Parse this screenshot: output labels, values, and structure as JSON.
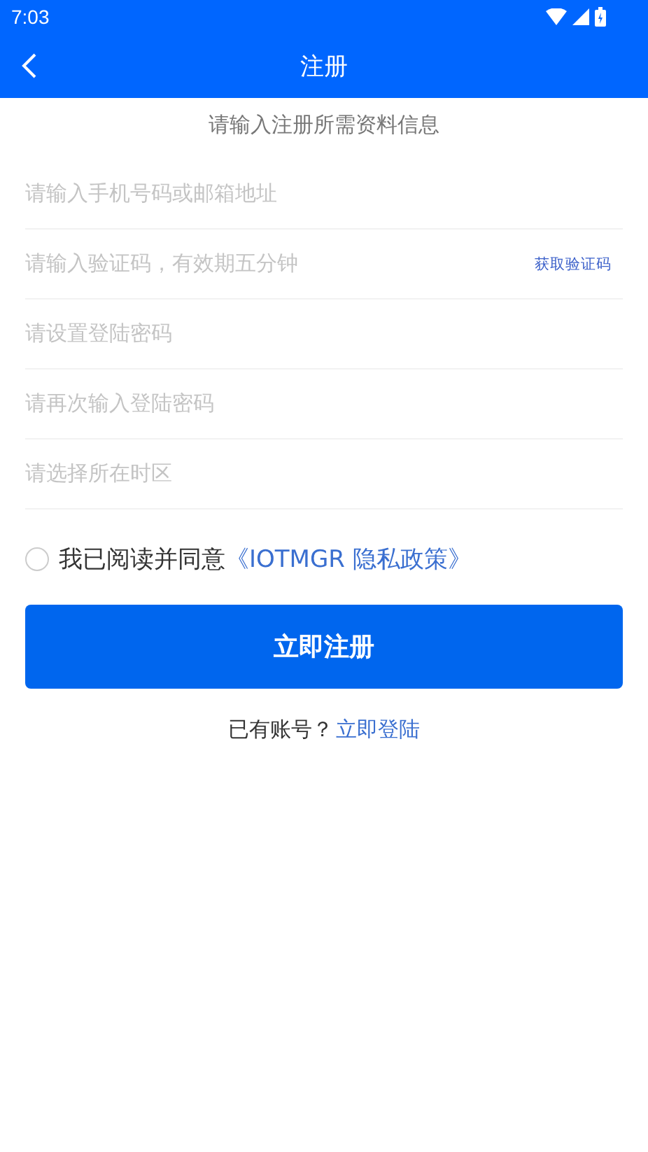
{
  "status_bar": {
    "time": "7:03"
  },
  "header": {
    "title": "注册"
  },
  "subtitle": "请输入注册所需资料信息",
  "fields": [
    {
      "placeholder": "请输入手机号码或邮箱地址"
    },
    {
      "placeholder": "请输入验证码，有效期五分钟",
      "action": "获取验证码"
    },
    {
      "placeholder": "请设置登陆密码"
    },
    {
      "placeholder": "请再次输入登陆密码"
    },
    {
      "placeholder": "请选择所在时区"
    }
  ],
  "agreement": {
    "checked": false,
    "text": "我已阅读并同意",
    "link": "《IOTMGR 隐私政策》"
  },
  "submit": "立即注册",
  "login": {
    "text": "已有账号？",
    "link": "立即登陆"
  }
}
